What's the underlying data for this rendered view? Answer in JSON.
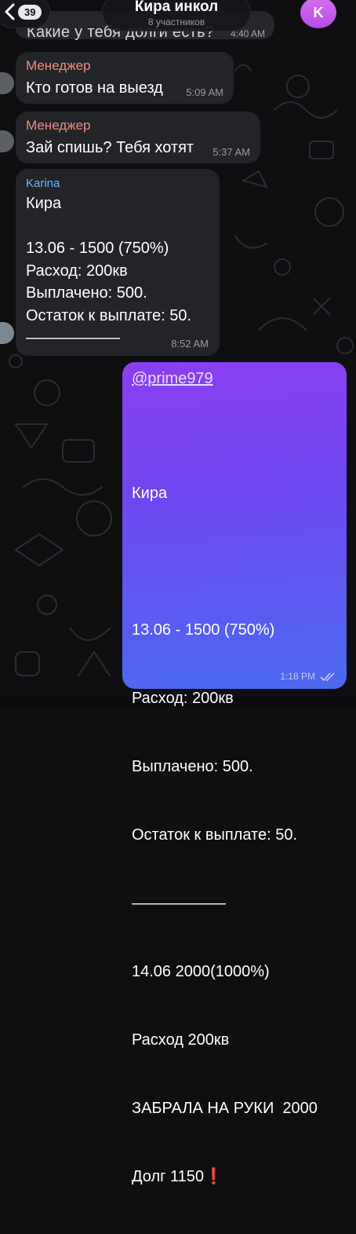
{
  "header": {
    "back_count": "39",
    "title": "Кира инкол",
    "subtitle": "8 участников",
    "avatar_letter": "K"
  },
  "previous_message": {
    "text": "Какие у тебя долги есть?",
    "time": "4:40 AM"
  },
  "messages": [
    {
      "sender": "Менеджер",
      "text": "Кто готов на выезд",
      "time": "5:09 AM"
    },
    {
      "sender": "Менеджер",
      "text": "Зай спишь? Тебя хотят",
      "time": "5:37 AM"
    },
    {
      "sender": "Karina",
      "lines": [
        "Кира",
        "",
        "13.06 - 1500 (750%)",
        "Расход: 200кв",
        "Выплачено: 500.",
        "Остаток к выплате: 50.",
        "——————"
      ],
      "time": "8:52 AM"
    }
  ],
  "outgoing": {
    "mention": "@prime979",
    "lines": [
      "Кира",
      "",
      "13.06 - 1500 (750%)",
      "Расход: 200кв",
      "Выплачено: 500.",
      "Остаток к выплате: 50.",
      "——————",
      "14.06 2000(1000%)",
      "Расход 200кв",
      "ЗАБРАЛА НА РУКИ  2000",
      "Долг 1150"
    ],
    "debt_mark": "❗",
    "time": "1:18 PM"
  }
}
